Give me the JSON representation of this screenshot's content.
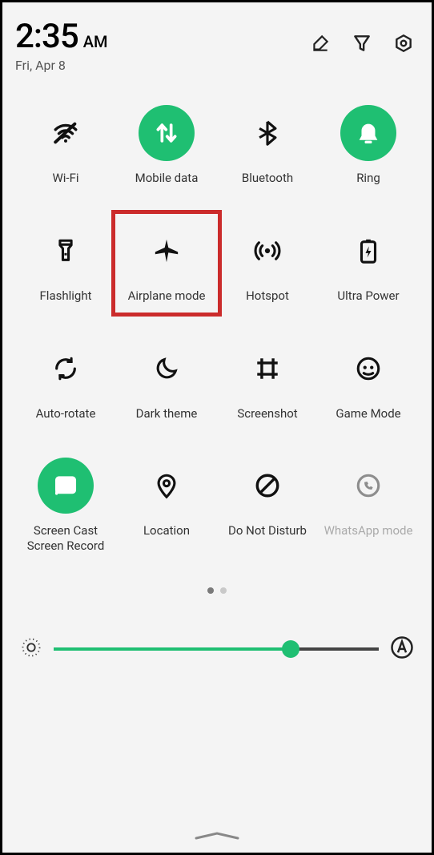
{
  "header": {
    "time": "2:35",
    "ampm": "AM",
    "date": "Fri, Apr 8"
  },
  "tiles": [
    {
      "id": "wifi",
      "label": "Wi-Fi",
      "on": false,
      "dim": false
    },
    {
      "id": "mobile-data",
      "label": "Mobile data",
      "on": true,
      "dim": false
    },
    {
      "id": "bluetooth",
      "label": "Bluetooth",
      "on": false,
      "dim": false
    },
    {
      "id": "ring",
      "label": "Ring",
      "on": true,
      "dim": false
    },
    {
      "id": "flashlight",
      "label": "Flashlight",
      "on": false,
      "dim": false
    },
    {
      "id": "airplane",
      "label": "Airplane mode",
      "on": false,
      "dim": false,
      "highlighted": true
    },
    {
      "id": "hotspot",
      "label": "Hotspot",
      "on": false,
      "dim": false
    },
    {
      "id": "ultra-power",
      "label": "Ultra Power",
      "on": false,
      "dim": false
    },
    {
      "id": "auto-rotate",
      "label": "Auto-rotate",
      "on": false,
      "dim": false
    },
    {
      "id": "dark-theme",
      "label": "Dark theme",
      "on": false,
      "dim": false
    },
    {
      "id": "screenshot",
      "label": "Screenshot",
      "on": false,
      "dim": false
    },
    {
      "id": "game-mode",
      "label": "Game Mode",
      "on": false,
      "dim": false
    },
    {
      "id": "screen-cast",
      "label": "Screen Cast\nScreen Record",
      "on": true,
      "dim": false
    },
    {
      "id": "location",
      "label": "Location",
      "on": false,
      "dim": false
    },
    {
      "id": "dnd",
      "label": "Do Not Disturb",
      "on": false,
      "dim": false
    },
    {
      "id": "whatsapp",
      "label": "WhatsApp mode",
      "on": false,
      "dim": true
    }
  ],
  "pagination": {
    "pages": 2,
    "active": 0
  },
  "brightness": {
    "value": 73,
    "auto": true
  },
  "colors": {
    "accent": "#1fbf72",
    "highlight": "#cb2b2b"
  }
}
